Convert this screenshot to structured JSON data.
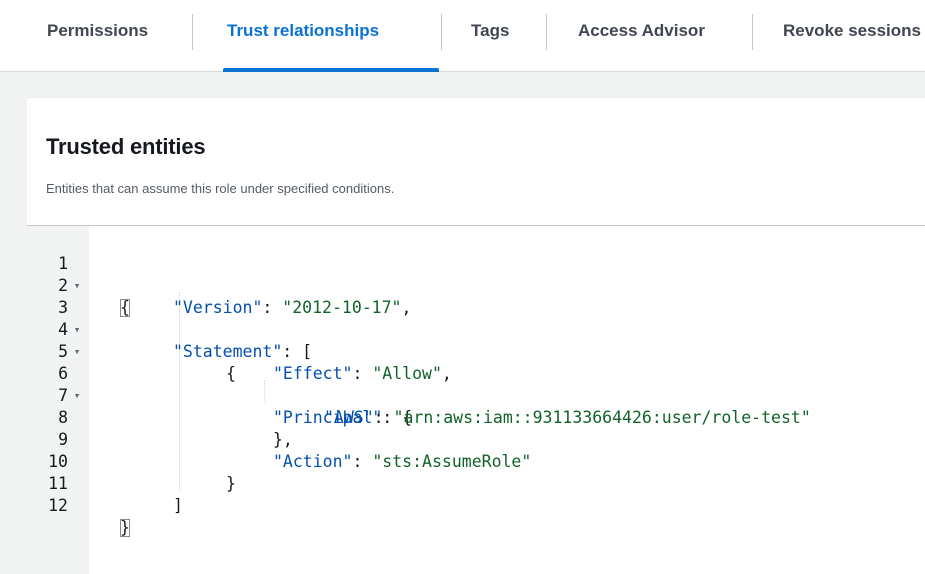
{
  "tabs": [
    {
      "label": "Permissions",
      "active": false
    },
    {
      "label": "Trust relationships",
      "active": true
    },
    {
      "label": "Tags",
      "active": false
    },
    {
      "label": "Access Advisor",
      "active": false
    },
    {
      "label": "Revoke sessions",
      "active": false
    }
  ],
  "panel": {
    "title": "Trusted entities",
    "description": "Entities that can assume this role under specified conditions."
  },
  "editor": {
    "lines": [
      {
        "number": "1",
        "foldable": true
      },
      {
        "number": "2",
        "foldable": false
      },
      {
        "number": "3",
        "foldable": true
      },
      {
        "number": "4",
        "foldable": true
      },
      {
        "number": "5",
        "foldable": false
      },
      {
        "number": "6",
        "foldable": true
      },
      {
        "number": "7",
        "foldable": false
      },
      {
        "number": "8",
        "foldable": false
      },
      {
        "number": "9",
        "foldable": false
      },
      {
        "number": "10",
        "foldable": false
      },
      {
        "number": "11",
        "foldable": false
      },
      {
        "number": "12",
        "foldable": false
      }
    ],
    "fold_glyph": "▾",
    "policy": {
      "version_key": "\"Version\"",
      "version_value": "\"2012-10-17\"",
      "statement_key": "\"Statement\"",
      "effect_key": "\"Effect\"",
      "effect_value": "\"Allow\"",
      "principal_key": "\"Principal\"",
      "aws_key": "\"AWS\"",
      "aws_value": "\"arn:aws:iam::931133664426:user/role-test\"",
      "action_key": "\"Action\"",
      "action_value": "\"sts:AssumeRole\""
    },
    "punctuation": {
      "open_brace": "{",
      "close_brace": "}",
      "open_bracket": "[",
      "close_bracket": "]",
      "colon": ": ",
      "comma": ",",
      "close_brace_comma": "},"
    }
  },
  "colors": {
    "accent": "#0972d3",
    "json_key": "#0550ae",
    "json_string": "#116329"
  }
}
